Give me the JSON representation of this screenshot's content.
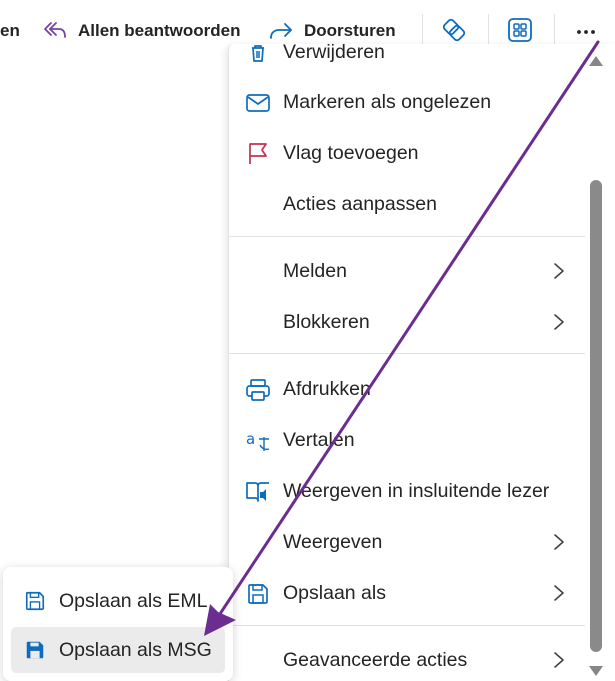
{
  "toolbar": {
    "reply_partial": "en",
    "reply_all": "Allen beantwoorden",
    "forward": "Doorsturen",
    "more_glyph": "···"
  },
  "menu": {
    "items": [
      {
        "label": "Verwijderen",
        "icon": "trash-icon"
      },
      {
        "label": "Markeren als ongelezen",
        "icon": "mail-icon"
      },
      {
        "label": "Vlag toevoegen",
        "icon": "flag-icon"
      },
      {
        "label": "Acties aanpassen",
        "icon": ""
      },
      {
        "label": "Melden",
        "icon": "",
        "submenu": true
      },
      {
        "label": "Blokkeren",
        "icon": "",
        "submenu": true
      },
      {
        "label": "Afdrukken",
        "icon": "printer-icon"
      },
      {
        "label": "Vertalen",
        "icon": "translate-icon"
      },
      {
        "label": "Weergeven in insluitende lezer",
        "icon": "immersive-reader-icon"
      },
      {
        "label": "Weergeven",
        "icon": "",
        "submenu": true
      },
      {
        "label": "Opslaan als",
        "icon": "save-icon",
        "submenu": true
      },
      {
        "label": "Geavanceerde acties",
        "icon": "",
        "submenu": true
      }
    ]
  },
  "submenu": {
    "items": [
      {
        "label": "Opslaan als EML",
        "icon": "save-outline-icon"
      },
      {
        "label": "Opslaan als MSG",
        "icon": "save-filled-icon",
        "active": true
      }
    ]
  },
  "colors": {
    "accent_blue": "#0f6cbd",
    "flag_red": "#c4314b",
    "reply_purple": "#7b3fa8",
    "arrow_purple": "#6b2d8f"
  }
}
